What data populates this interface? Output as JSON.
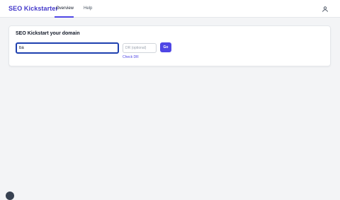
{
  "header": {
    "brand": "SEO Kickstarter",
    "tabs": [
      {
        "label": "Overview",
        "active": true
      },
      {
        "label": "Help",
        "active": false
      }
    ],
    "avatar_icon": "user-icon"
  },
  "card": {
    "title": "SEO Kickstart your domain",
    "domain_input": {
      "value": "ba",
      "placeholder": ""
    },
    "dr_input": {
      "value": "",
      "placeholder": "DR (optional)"
    },
    "check_dr_label": "Check DR",
    "go_label": "Go"
  },
  "colors": {
    "brand": "#4338ca",
    "accent": "#4f46e5",
    "focus": "#1e40af",
    "background": "#f3f4f6"
  }
}
